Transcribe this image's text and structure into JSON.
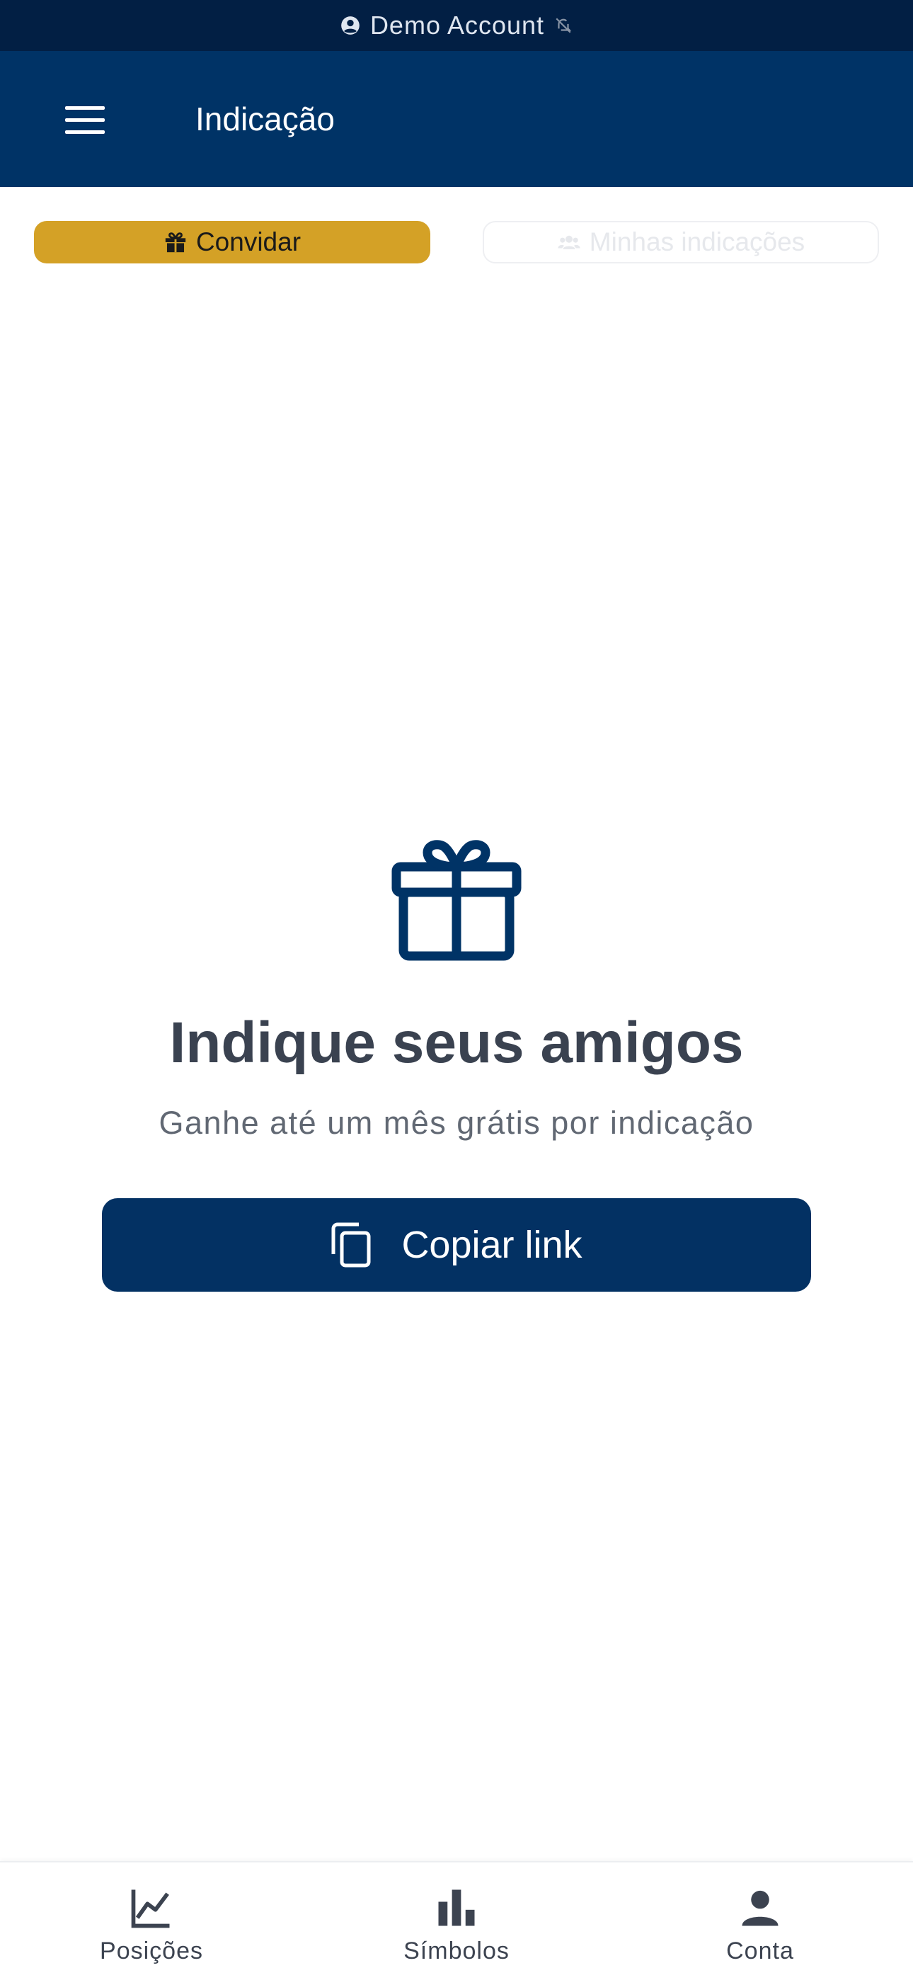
{
  "demo_bar": {
    "label": "Demo Account",
    "account_icon": "account-circle-icon",
    "status_icon": "muted-icon"
  },
  "header": {
    "title": "Indicação",
    "menu_icon": "hamburger-menu-icon"
  },
  "tabs": [
    {
      "label": "Convidar",
      "icon": "gift-icon",
      "active": true
    },
    {
      "label": "Minhas indicações",
      "icon": "users-icon",
      "active": false
    }
  ],
  "main": {
    "icon": "gift-icon",
    "headline": "Indique seus amigos",
    "subline": "Ganhe até um mês grátis por indicação",
    "copy_button": {
      "label": "Copiar link",
      "icon": "copy-icon"
    }
  },
  "bottom_nav": [
    {
      "label": "Posições",
      "icon": "line-chart-icon"
    },
    {
      "label": "Símbolos",
      "icon": "bar-chart-icon"
    },
    {
      "label": "Conta",
      "icon": "person-icon"
    }
  ],
  "colors": {
    "header": "#003366",
    "demo_bar": "#021f44",
    "accent": "#d4a126",
    "primary_button": "#033163"
  }
}
